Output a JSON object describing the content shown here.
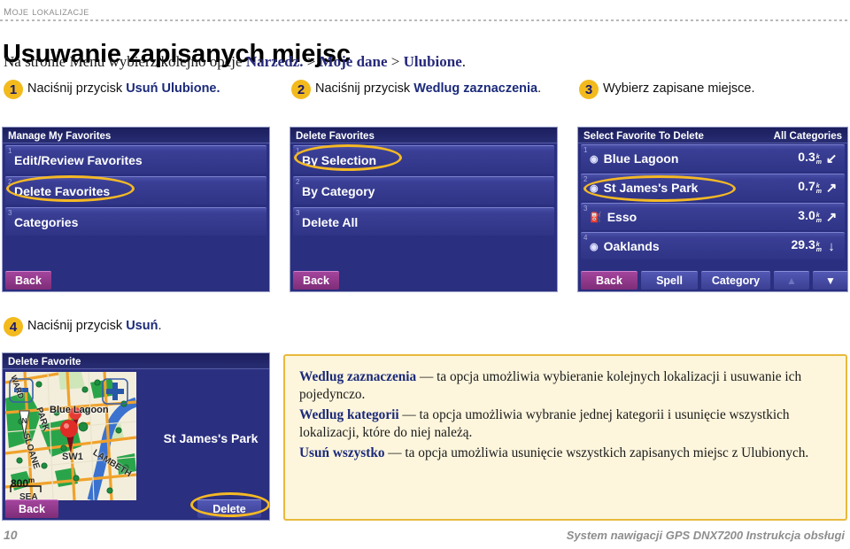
{
  "running_head": "Moje lokalizacje",
  "page_title": "Usuwanie zapisanych miejsc",
  "subtitle": {
    "lead": "Na stronie Menu wybierz kolejno opcje ",
    "crumb1": "Narzedz.",
    "sep1": " > ",
    "crumb2": "Moje dane",
    "sep2": " > ",
    "crumb3": "Ulubione",
    "end": "."
  },
  "steps": [
    {
      "num": "1",
      "pre": "Naciśnij przycisk ",
      "bold": "Usuń Ulubione.",
      "post": ""
    },
    {
      "num": "2",
      "pre": "Naciśnij przycisk ",
      "bold": "Wedlug zaznaczenia",
      "post": "."
    },
    {
      "num": "3",
      "pre": "Wybierz zapisane miejsce.",
      "bold": "",
      "post": ""
    },
    {
      "num": "4",
      "pre": "Naciśnij przycisk ",
      "bold": "Usuń",
      "post": "."
    }
  ],
  "screen1": {
    "title": "Manage My Favorites",
    "rows": [
      {
        "idx": "1",
        "label": "Edit/Review Favorites"
      },
      {
        "idx": "2",
        "label": "Delete Favorites"
      },
      {
        "idx": "3",
        "label": "Categories"
      }
    ],
    "back": "Back"
  },
  "screen2": {
    "title": "Delete Favorites",
    "rows": [
      {
        "idx": "1",
        "label": "By Selection"
      },
      {
        "idx": "2",
        "label": "By Category"
      },
      {
        "idx": "3",
        "label": "Delete All"
      }
    ],
    "back": "Back"
  },
  "screen3": {
    "title": "Select Favorite To Delete",
    "title_right": "All Categories",
    "rows": [
      {
        "idx": "1",
        "label": "Blue Lagoon",
        "dist": "0.3",
        "u1": "k",
        "u2": "m",
        "arrow": "↙",
        "poi": "◉"
      },
      {
        "idx": "2",
        "label": "St James's Park",
        "dist": "0.7",
        "u1": "k",
        "u2": "m",
        "arrow": "↗",
        "poi": "◉"
      },
      {
        "idx": "3",
        "label": "Esso",
        "dist": "3.0",
        "u1": "k",
        "u2": "m",
        "arrow": "↗",
        "poi": "⛽"
      },
      {
        "idx": "4",
        "label": "Oaklands",
        "dist": "29.3",
        "u1": "k",
        "u2": "m",
        "arrow": "↓",
        "poi": "◉"
      }
    ],
    "buttons": {
      "back": "Back",
      "spell": "Spell",
      "category": "Category",
      "up": "▲",
      "down": "▼"
    }
  },
  "screen4": {
    "title": "Delete Favorite",
    "place_label": "St James's Park",
    "back": "Back",
    "delete": "Delete",
    "map": {
      "zoom_out": "−",
      "zoom_in": "+",
      "scale": "800",
      "scale_unit": "m",
      "labels": [
        "Blue Lagoon",
        "PARK",
        "SLOANE",
        "SW1",
        "LAMBETH",
        "WARD",
        "SEA"
      ]
    }
  },
  "infobox": {
    "items": [
      {
        "bold": "Wedlug zaznaczenia",
        "text": " — ta opcja umożliwia wybieranie kolejnych lokalizacji i usuwanie ich pojedynczo."
      },
      {
        "bold": "Wedlug kategorii",
        "text": " — ta opcja umożliwia wybranie jednej kategorii i usunięcie wszystkich lokalizacji, które do niej należą."
      },
      {
        "bold": "Usuń wszystko",
        "text": " — ta opcja umożliwia usunięcie wszystkich zapisanych miejsc z Ulubionych."
      }
    ]
  },
  "footer": {
    "page_number": "10",
    "manual_title": "System nawigacji GPS DNX7200 Instrukcja obsługi"
  },
  "colors": {
    "accent_yellow": "#f3ba1d",
    "heading_blue": "#1b2a7a",
    "screen_bg": "#2a2f80",
    "infobox_bg": "#fdf6dd",
    "infobox_border": "#e8b93c"
  }
}
